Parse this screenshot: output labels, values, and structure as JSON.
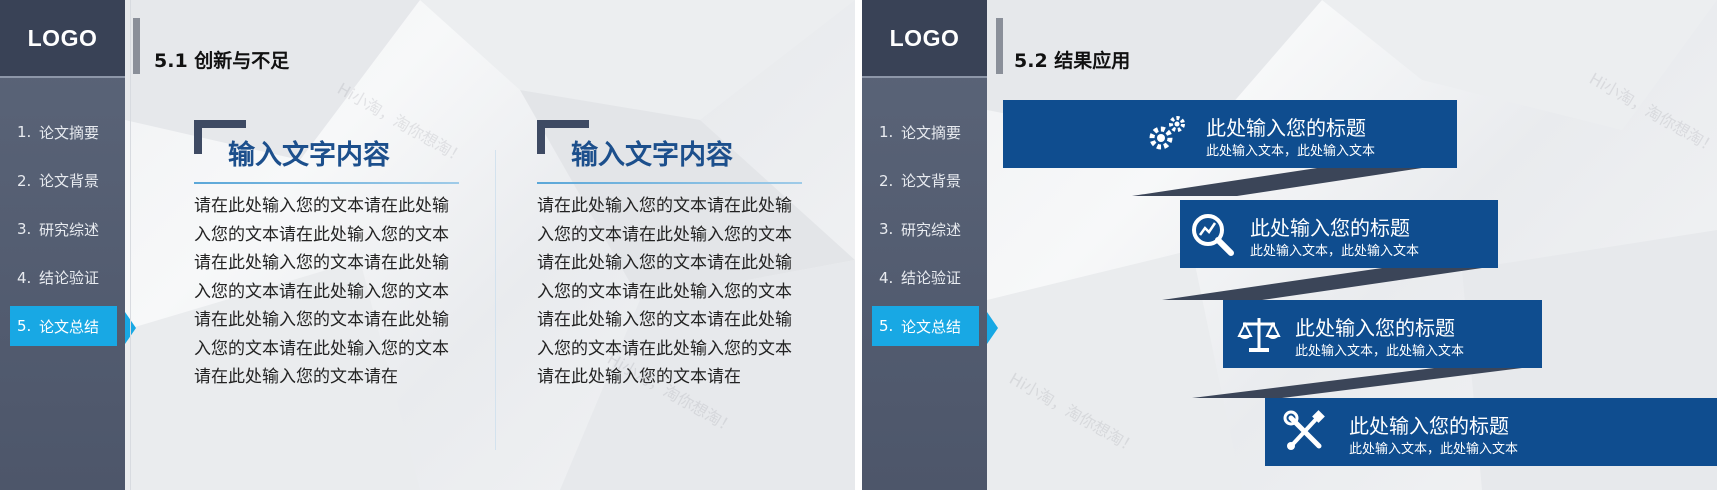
{
  "colors": {
    "accent": "#18a8e4",
    "brand_blue": "#0f4d8f",
    "sidebar": "#505a6e",
    "heading_blue": "#1c4f8c"
  },
  "slides": [
    {
      "logo": "LOGO",
      "menu": [
        {
          "num": "1.",
          "label": "论文摘要"
        },
        {
          "num": "2.",
          "label": "论文背景"
        },
        {
          "num": "3.",
          "label": "研究综述"
        },
        {
          "num": "4.",
          "label": "结论验证"
        },
        {
          "num": "5.",
          "label": "论文总结",
          "active": true
        }
      ],
      "title": "5.1 创新与不足",
      "columns": [
        {
          "heading": "输入文字内容",
          "body": "请在此处输入您的文本请在此处输入您的文本请在此处输入您的文本请在此处输入您的文本请在此处输入您的文本请在此处输入您的文本请在此处输入您的文本请在此处输入您的文本请在此处输入您的文本请在此处输入您的文本请在"
        },
        {
          "heading": "输入文字内容",
          "body": "请在此处输入您的文本请在此处输入您的文本请在此处输入您的文本请在此处输入您的文本请在此处输入您的文本请在此处输入您的文本请在此处输入您的文本请在此处输入您的文本请在此处输入您的文本请在此处输入您的文本请在"
        }
      ],
      "watermarks": [
        "Hi小淘，淘你想淘！",
        "Hi小淘，淘你想淘！"
      ]
    },
    {
      "logo": "LOGO",
      "menu": [
        {
          "num": "1.",
          "label": "论文摘要"
        },
        {
          "num": "2.",
          "label": "论文背景"
        },
        {
          "num": "3.",
          "label": "研究综述"
        },
        {
          "num": "4.",
          "label": "结论验证"
        },
        {
          "num": "5.",
          "label": "论文总结",
          "active": true
        }
      ],
      "title": "5.2 结果应用",
      "steps": [
        {
          "icon": "gears-icon",
          "title": "此处输入您的标题",
          "subtitle": "此处输入文本，此处输入文本"
        },
        {
          "icon": "magnifier-chart-icon",
          "title": "此处输入您的标题",
          "subtitle": "此处输入文本，此处输入文本"
        },
        {
          "icon": "scales-icon",
          "title": "此处输入您的标题",
          "subtitle": "此处输入文本，此处输入文本"
        },
        {
          "icon": "wrench-screwdriver-icon",
          "title": "此处输入您的标题",
          "subtitle": "此处输入文本，此处输入文本"
        }
      ],
      "watermarks": [
        "Hi小淘，淘你想淘！",
        "Hi小淘，淘你想淘！"
      ]
    }
  ]
}
